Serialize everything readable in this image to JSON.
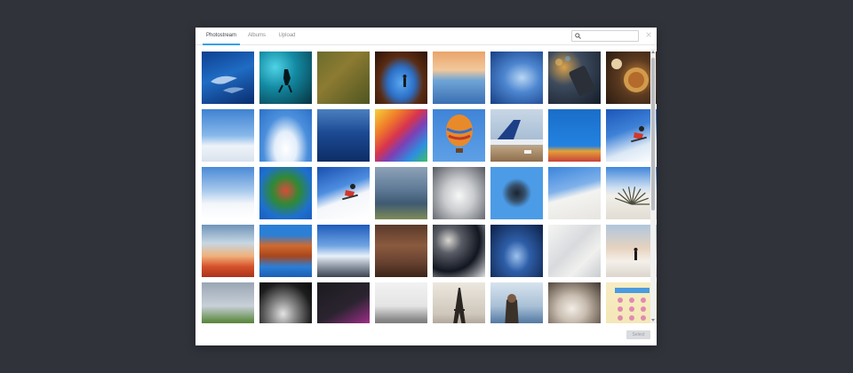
{
  "tabs": [
    {
      "label": "Photostream",
      "active": true
    },
    {
      "label": "Albums",
      "active": false
    },
    {
      "label": "Upload",
      "active": false
    }
  ],
  "search": {
    "value": "",
    "placeholder": ""
  },
  "colors": {
    "backdrop": "#31333b",
    "accent": "#37a0e8",
    "select_disabled_bg": "#d9dbde"
  },
  "photos": [
    {
      "name": "dolphins-underwater",
      "bg": "linear-gradient(160deg,#0e3f8f 0%,#1f6cc4 45%,#0a2c6e 100%)",
      "shape": "dolphin"
    },
    {
      "name": "scuba-diver",
      "bg": "radial-gradient(circle at 30% 30%,#4fd3e6 0%,#138aa3 40%,#06323f 100%)",
      "shape": "diver"
    },
    {
      "name": "aerial-vineyard",
      "bg": "linear-gradient(135deg,#6b6c2c 0%,#8c7b32 40%,#4f5521 100%)",
      "shape": "none"
    },
    {
      "name": "rock-arch",
      "bg": "radial-gradient(ellipse at 50% 60%,#5aa8f0 0%,#2c70c8 35%,#5a2b12 60%,#2b1206 100%)",
      "shape": "person"
    },
    {
      "name": "sunset-sea",
      "bg": "linear-gradient(180deg,#e9a46b 0%,#f2c89b 35%,#6fa5d6 55%,#3a6fb3 100%)",
      "shape": "none"
    },
    {
      "name": "blue-wave-light",
      "bg": "radial-gradient(ellipse at 60% 50%,#b9d7f4 0%,#4d86d0 40%,#163e84 100%)",
      "shape": "none"
    },
    {
      "name": "phone-bokeh",
      "bg": "radial-gradient(circle at 30% 30%,#d9a24a 0%,#3d4b5e 35%,#141c28 100%)",
      "shape": "phone"
    },
    {
      "name": "food-bowls",
      "bg": "radial-gradient(circle at 60% 50%,#c78438 0%,#5b3a20 45%,#2a1b10 100%)",
      "shape": "bowl"
    },
    {
      "name": "snowy-mountain",
      "bg": "linear-gradient(180deg,#3f82d2 0%,#87b8ea 50%,#eef3f8 70%,#d9e3ee 100%)",
      "shape": "none"
    },
    {
      "name": "clouds-blue-sky",
      "bg": "radial-gradient(ellipse at 50% 75%,#ffffff 0%,#e3eefa 30%,#4b8fdc 60%,#2c71c8 100%)",
      "shape": "none"
    },
    {
      "name": "harbor-night",
      "bg": "linear-gradient(180deg,#4b7fc0 0%,#1c4a93 45%,#0d2d66 100%)",
      "shape": "none"
    },
    {
      "name": "rainbow-pencils",
      "bg": "linear-gradient(135deg,#f4d23a 0%,#f07d2a 25%,#d8344d 45%,#7d3fb6 60%,#2d8ee0 80%,#3bbf69 100%)",
      "shape": "none"
    },
    {
      "name": "hot-air-balloon",
      "bg": "linear-gradient(180deg,#3f84d8 0%,#5ea0e6 100%)",
      "shape": "balloon"
    },
    {
      "name": "airplane-tail",
      "bg": "linear-gradient(180deg,#c8d7e6 0%,#a9bfd6 55%,#b79b79 75%,#8d6d4c 100%)",
      "shape": "tail"
    },
    {
      "name": "blue-sweets",
      "bg": "linear-gradient(180deg,#1a6ec9 0%,#2382e0 70%,#e3a038 80%,#c8423a 100%)",
      "shape": "none"
    },
    {
      "name": "snowboard-rider",
      "bg": "linear-gradient(160deg,#1c56b8 0%,#3e82d8 40%,#dbe8f5 70%,#ffffff 100%)",
      "shape": "rider"
    },
    {
      "name": "alps-ski",
      "bg": "linear-gradient(180deg,#4a8ad6 0%,#a7c9ec 45%,#f3f6fa 70%,#ffffff 100%)",
      "shape": "none"
    },
    {
      "name": "vegetable-art",
      "bg": "radial-gradient(circle at 50% 45%,#d94b3a 0%,#2f8a35 35%,#1e6fd0 70%,#1a5dbb 100%)",
      "shape": "none"
    },
    {
      "name": "ski-jump",
      "bg": "linear-gradient(160deg,#1a4fb0 0%,#4d8ee0 40%,#f4f6fa 60%,#ffffff 100%)",
      "shape": "rider"
    },
    {
      "name": "lake-island",
      "bg": "linear-gradient(180deg,#8da2b8 0%,#627d99 40%,#3f5a72 70%,#7d8b57 100%)",
      "shape": "none"
    },
    {
      "name": "glacier-aerial",
      "bg": "radial-gradient(ellipse at 50% 55%,#f7f7f7 0%,#c9cbce 40%,#545860 100%)",
      "shape": "none"
    },
    {
      "name": "spiky-sphere",
      "bg": "radial-gradient(circle at 50% 50%,#1a2430 0%,#36506b 22%,#4c9be6 40%,#4c9be6 100%)",
      "shape": "none"
    },
    {
      "name": "white-dunes",
      "bg": "linear-gradient(165deg,#3b85dc 0%,#7fb1ea 40%,#f3f3f1 55%,#e7e5e0 100%)",
      "shape": "none"
    },
    {
      "name": "desert-plant",
      "bg": "linear-gradient(180deg,#3f86da 0%,#cfe0f2 40%,#f1efe9 55%,#e2ddd3 100%)",
      "shape": "plant"
    },
    {
      "name": "planet-desert",
      "bg": "linear-gradient(180deg,#6e93b8 0%,#c6d7e4 35%,#f0b07a 60%,#d6512b 80%,#a8331b 100%)",
      "shape": "none"
    },
    {
      "name": "red-rock-reflection",
      "bg": "linear-gradient(180deg,#2b7fd6 0%,#2b7fd6 20%,#cf6a2f 40%,#a8461c 60%,#2b7fd6 80%,#1c5eb3 100%)",
      "shape": "none"
    },
    {
      "name": "sky-over-mountains",
      "bg": "linear-gradient(180deg,#1f5bbb 0%,#6fa4e2 40%,#e9f1fa 60%,#8d96a3 80%,#3d4552 100%)",
      "shape": "none"
    },
    {
      "name": "desert-city",
      "bg": "linear-gradient(180deg,#5a3a2a 0%,#8a5a3e 40%,#6a4331 70%,#3b2519 100%)",
      "shape": "none"
    },
    {
      "name": "moon-earth",
      "bg": "radial-gradient(circle at 30% 30%,#d9d7d2 0%,#5a5d66 25%,#121620 60%,#dfe1e4 100%)",
      "shape": "none"
    },
    {
      "name": "blue-wave-night",
      "bg": "radial-gradient(ellipse at 50% 60%,#9cc1ee 0%,#2e5ea8 35%,#0c1f44 100%)",
      "shape": "none"
    },
    {
      "name": "sand-texture",
      "bg": "linear-gradient(135deg,#f5f5f3 0%,#d8dadd 45%,#f0f0ee 70%,#c9ccd0 100%)",
      "shape": "none"
    },
    {
      "name": "snow-peak-person",
      "bg": "linear-gradient(180deg,#b0c6dc 0%,#e7d3c0 45%,#f4f0ea 70%,#dcd6cd 100%)",
      "shape": "person"
    },
    {
      "name": "green-valley",
      "bg": "linear-gradient(180deg,#9aa6b4 0%,#c8d0d8 45%,#5e8a42 75%,#3a6a26 100%)",
      "shape": "none"
    },
    {
      "name": "dog-portrait",
      "bg": "radial-gradient(ellipse at 45% 60%,#e3e3e3 0%,#8a8a8a 30%,#1d1d1d 70%,#0c0c0c 100%)",
      "shape": "none"
    },
    {
      "name": "dark-workshop",
      "bg": "linear-gradient(150deg,#1b1b1f 0%,#2b2430 50%,#8a2c7a 80%,#e24f9a 100%)",
      "shape": "none"
    },
    {
      "name": "snowy-range",
      "bg": "linear-gradient(180deg,#f2f2f2 0%,#e4e4e4 45%,#8d8d8d 70%,#4e4e4e 100%)",
      "shape": "none"
    },
    {
      "name": "eiffel-tower",
      "bg": "linear-gradient(180deg,#ece7df 0%,#cfc7bb 60%,#8a8074 100%)",
      "shape": "tower"
    },
    {
      "name": "man-by-water",
      "bg": "linear-gradient(180deg,#d7e3ee 0%,#a9c0d6 45%,#5b7fa6 75%,#2e4f73 100%)",
      "shape": "man"
    },
    {
      "name": "woman-portrait",
      "bg": "radial-gradient(ellipse at 45% 50%,#f2ede6 0%,#c9beb1 35%,#7f7266 70%,#3e362f 100%)",
      "shape": "none"
    },
    {
      "name": "cartoon-poster",
      "bg": "linear-gradient(180deg,#f7ecc2 0%,#f3e6b5 100%)",
      "shape": "poster"
    }
  ],
  "footer": {
    "select_label": "Select"
  }
}
